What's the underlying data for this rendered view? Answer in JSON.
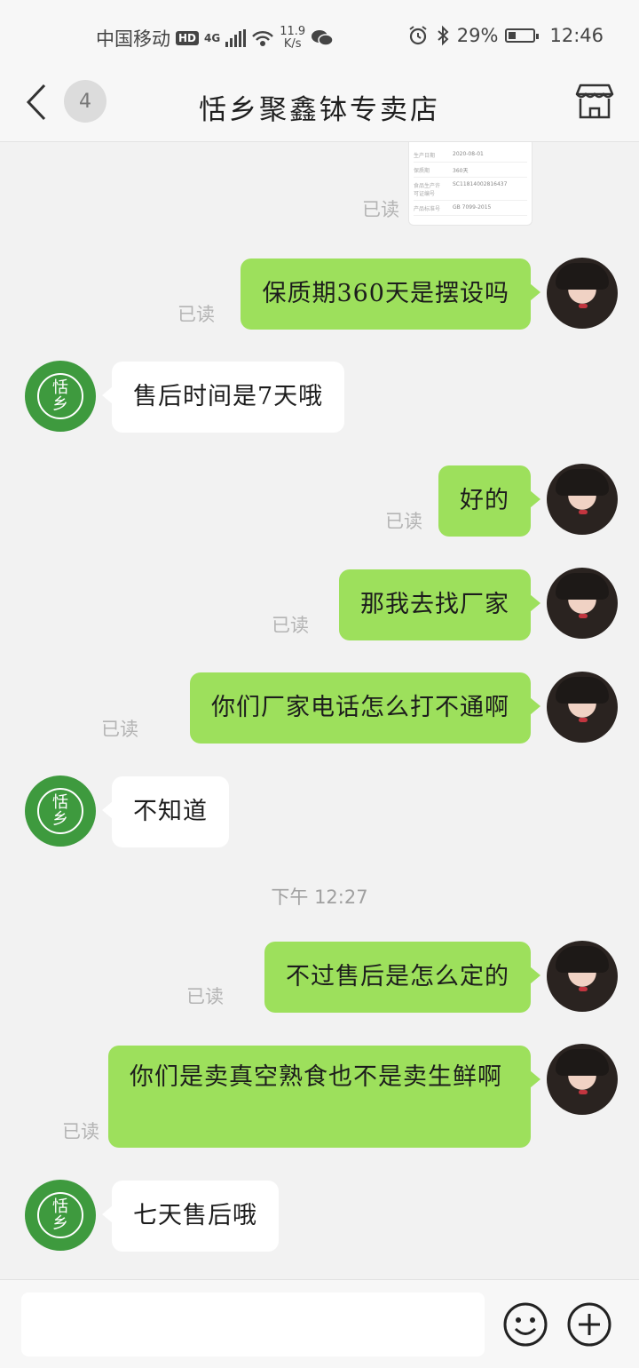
{
  "status_bar": {
    "carrier": "中国移动",
    "hd": "HD",
    "network": "4G",
    "speed_value": "11.9",
    "speed_unit": "K/s",
    "battery": "29%",
    "time": "12:46"
  },
  "header": {
    "unread_count": "4",
    "title": "恬乡聚鑫钵专卖店"
  },
  "image_message": {
    "rows": [
      {
        "key": "生产日期",
        "value": "2020-08-01"
      },
      {
        "key": "保质期",
        "value": "360天"
      },
      {
        "key": "食品生产许可证编号",
        "value": "SC11814002816437"
      },
      {
        "key": "产品标准号",
        "value": "GB 7099-2015"
      }
    ]
  },
  "read_label": "已读",
  "shop_avatar": {
    "line1": "恬",
    "line2": "乡"
  },
  "messages": [
    {
      "text": "保质期360天是摆设吗"
    },
    {
      "text": "售后时间是7天哦"
    },
    {
      "text": "好的"
    },
    {
      "text": "那我去找厂家"
    },
    {
      "text": "你们厂家电话怎么打不通啊"
    },
    {
      "text": "不知道"
    },
    {
      "text": "不过售后是怎么定的"
    },
    {
      "text": "你们是卖真空熟食也不是卖生鲜啊"
    },
    {
      "text": "七天售后哦"
    }
  ],
  "time_separator": "下午  12:27",
  "input": {
    "value": "",
    "placeholder": ""
  },
  "colors": {
    "outgoing_bubble": "#9de05c",
    "incoming_bubble": "#ffffff",
    "shop_avatar": "#3e9a3e",
    "background": "#f2f2f2"
  },
  "icons": [
    "back-icon",
    "store-icon",
    "emoji-icon",
    "plus-icon",
    "alarm-icon",
    "bluetooth-icon",
    "wifi-icon",
    "wechat-icon"
  ]
}
